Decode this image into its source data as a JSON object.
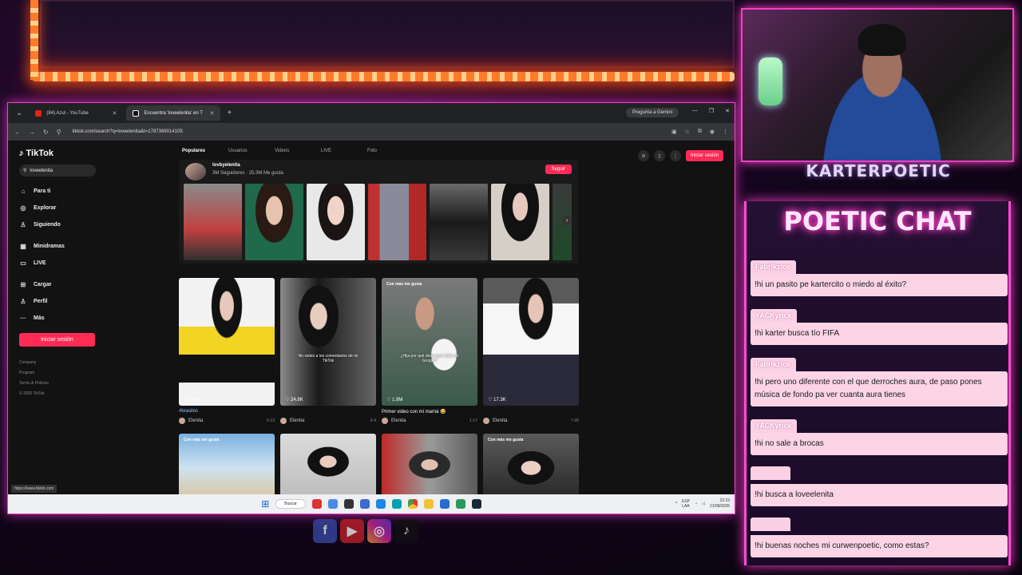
{
  "browser": {
    "tabs": [
      {
        "label": "(84) Azul - YouTube",
        "active": false
      },
      {
        "label": "Encuentra 'loveelenita' en T",
        "active": true
      }
    ],
    "gemini_label": "Pregunta a Gemini",
    "url": "tiktok.com/search?q=loveelenita&t=1787369014105",
    "status_url": "https://www.tiktok.com"
  },
  "tiktok": {
    "logo": "TikTok",
    "search_value": "loveelenita",
    "nav": [
      {
        "icon": "home-icon",
        "glyph": "⌂",
        "label": "Para ti"
      },
      {
        "icon": "compass-icon",
        "glyph": "◎",
        "label": "Explorar"
      },
      {
        "icon": "following-icon",
        "glyph": "♙",
        "label": "Siguiendo"
      }
    ],
    "nav2": [
      {
        "icon": "minidramas-icon",
        "glyph": "▦",
        "label": "Minidramas"
      },
      {
        "icon": "live-icon",
        "glyph": "▭",
        "label": "LIVE"
      }
    ],
    "nav3": [
      {
        "icon": "upload-icon",
        "glyph": "⊞",
        "label": "Cargar"
      },
      {
        "icon": "profile-icon",
        "glyph": "♙",
        "label": "Perfil"
      },
      {
        "icon": "more-icon",
        "glyph": "···",
        "label": "Más"
      }
    ],
    "login_label": "Iniciar sesión",
    "footer": [
      "Company",
      "Program",
      "Terms & Policies",
      "© 2026 TikTok"
    ],
    "search_tabs": [
      "Populares",
      "Usuarios",
      "Videos",
      "LIVE",
      "Foto"
    ],
    "user": {
      "name": "lovbyelenita",
      "stats": "3M Seguidores  ·  25.3M Me gusta",
      "follow_label": "Seguir"
    },
    "videos": [
      {
        "badge": "",
        "caption": "",
        "views": "24.5K",
        "desc": "#brasilos",
        "desc_is_tag": true,
        "author": "Elenita",
        "date": "6-13"
      },
      {
        "badge": "",
        "caption": "No vistes a los comentarios de mi TikTok",
        "views": "24.8K",
        "desc": "",
        "desc_is_tag": false,
        "author": "Elenita",
        "date": "6-4"
      },
      {
        "badge": "Con más me gusta",
        "caption": "¿Hija por qué dices que estás en Google?",
        "views": "1.9M",
        "desc": "Primer video con mi mamá 😂",
        "desc_is_tag": false,
        "author": "Elenita",
        "date": "1-17"
      },
      {
        "badge": "",
        "caption": "",
        "views": "17.3K",
        "desc": "",
        "desc_is_tag": false,
        "author": "Elenita",
        "date": "7-25"
      },
      {
        "badge": "Con más me gusta",
        "caption": "",
        "views": "",
        "desc": "",
        "desc_is_tag": false,
        "author": "",
        "date": ""
      },
      {
        "badge": "",
        "caption": "",
        "views": "",
        "desc": "",
        "desc_is_tag": false,
        "author": "",
        "date": ""
      },
      {
        "badge": "",
        "caption": "",
        "views": "",
        "desc": "",
        "desc_is_tag": false,
        "author": "",
        "date": ""
      },
      {
        "badge": "Con más me gusta",
        "caption": "",
        "views": "",
        "desc": "",
        "desc_is_tag": false,
        "author": "",
        "date": ""
      }
    ]
  },
  "taskbar": {
    "search_label": "Buscar",
    "lang": "ESP\nLAA",
    "time": "22:23",
    "date": "21/08/2026"
  },
  "stream": {
    "streamer_name": "KARTERPOETIC",
    "chat_title": "POETIC CHAT",
    "messages": [
      {
        "user": "Fabrikzioe",
        "text": "!hi un pasito pe kartercito o miedo al éxito?"
      },
      {
        "user": "YACKyrick",
        "text": "!hi karter busca tío FIFA"
      },
      {
        "user": "Fabrikzioe",
        "text": "!hi pero uno diferente con el que derroches aura, de paso pones música de fondo pa ver cuanta aura tienes"
      },
      {
        "user": "YACKyrick",
        "text": "!hi no sale a brocas"
      },
      {
        "user": "",
        "text": "!hi busca a loveelenita"
      },
      {
        "user": "",
        "text": "!hi buenas noches mi curwenpoetic, como estas?"
      }
    ]
  },
  "colors": {
    "accent": "#fe2c55",
    "neon": "#ff3cc8",
    "chat_bubble": "#fcd4e6"
  }
}
